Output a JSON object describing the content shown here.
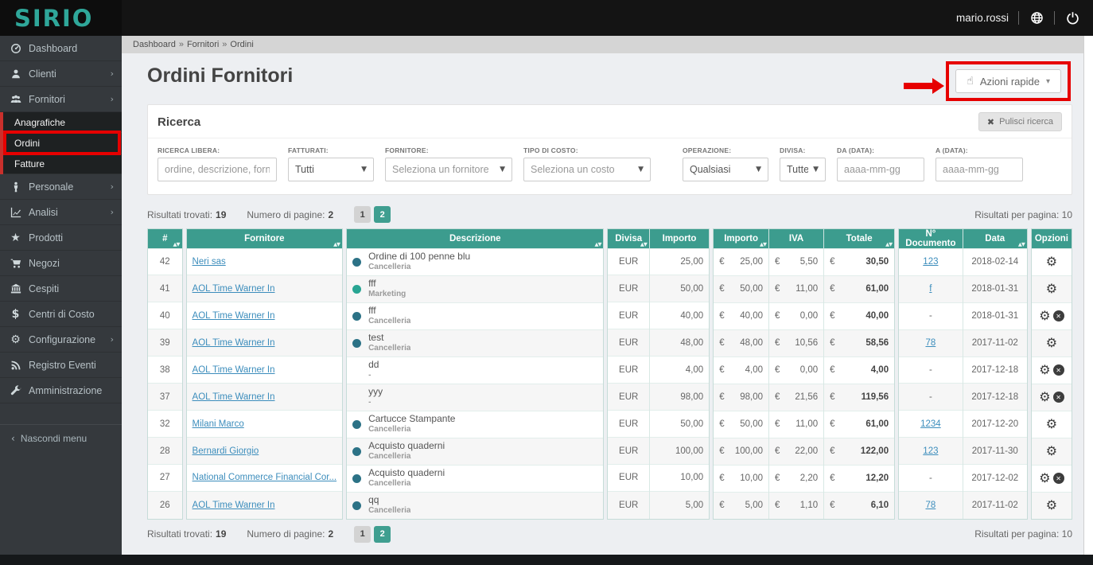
{
  "colors": {
    "accent_teal": "#3c9c8e",
    "logo_teal": "#2fa79a",
    "link_blue": "#3c8dbc",
    "annotation_red": "#e60000",
    "dot_blue": "#2c7286",
    "dot_teal": "#28a593",
    "sidebar_bg": "#35393d",
    "topbar_bg": "#141414"
  },
  "topbar": {
    "logo": "SIRIO",
    "username": "mario.rossi",
    "icons": [
      "globe-icon",
      "power-icon"
    ]
  },
  "sidebar": {
    "items": [
      {
        "id": "dashboard",
        "icon": "dashboard-icon",
        "label": "Dashboard"
      },
      {
        "id": "clienti",
        "icon": "user-icon",
        "label": "Clienti",
        "arrow": true
      },
      {
        "id": "fornitori",
        "icon": "users-icon",
        "label": "Fornitori",
        "arrow": true,
        "submenu": [
          {
            "id": "anagrafiche",
            "label": "Anagrafiche"
          },
          {
            "id": "ordini",
            "label": "Ordini",
            "annotated": true
          },
          {
            "id": "fatture",
            "label": "Fatture"
          }
        ]
      },
      {
        "id": "personale",
        "icon": "person-icon",
        "label": "Personale",
        "arrow": true
      },
      {
        "id": "analisi",
        "icon": "chart-icon",
        "label": "Analisi",
        "arrow": true
      },
      {
        "id": "prodotti",
        "icon": "star-icon",
        "label": "Prodotti"
      },
      {
        "id": "negozi",
        "icon": "cart-icon",
        "label": "Negozi"
      },
      {
        "id": "cespiti",
        "icon": "bank-icon",
        "label": "Cespiti"
      },
      {
        "id": "centri-di-costo",
        "icon": "dollar-icon",
        "label": "Centri di Costo"
      },
      {
        "id": "configurazione",
        "icon": "gear-icon",
        "label": "Configurazione",
        "arrow": true
      },
      {
        "id": "registro-eventi",
        "icon": "rss-icon",
        "label": "Registro Eventi"
      },
      {
        "id": "amministrazione",
        "icon": "wrench-icon",
        "label": "Amministrazione"
      }
    ],
    "hide_menu_label": "Nascondi menu"
  },
  "breadcrumb": [
    "Dashboard",
    "Fornitori",
    "Ordini"
  ],
  "page": {
    "title": "Ordini Fornitori"
  },
  "quick_actions": {
    "label": "Azioni rapide"
  },
  "search": {
    "panel_title": "Ricerca",
    "clear_label": "Pulisci ricerca",
    "fields": [
      {
        "label": "Ricerca libera:",
        "type": "text",
        "placeholder": "ordine, descrizione, forn"
      },
      {
        "label": "Fatturati:",
        "type": "select",
        "value": "Tutti",
        "placeholder_style": false
      },
      {
        "label": "Fornitore:",
        "type": "select",
        "value": "Seleziona un fornitore",
        "placeholder_style": true
      },
      {
        "label": "Tipo di costo:",
        "type": "select",
        "value": "Seleziona un costo",
        "placeholder_style": true
      },
      {
        "label": "Operazione:",
        "type": "select",
        "value": "Qualsiasi",
        "placeholder_style": false
      },
      {
        "label": "Divisa:",
        "type": "select",
        "value": "Tutte",
        "placeholder_style": false
      },
      {
        "label": "Da (data):",
        "type": "text",
        "placeholder": "aaaa-mm-gg"
      },
      {
        "label": "A (data):",
        "type": "text",
        "placeholder": "aaaa-mm-gg"
      }
    ]
  },
  "results": {
    "found_label": "Risultati trovati:",
    "found": "19",
    "pages_label": "Numero di pagine:",
    "pages": "2",
    "per_page_label": "Risultati per pagina:",
    "per_page": "10",
    "page_buttons": [
      "1",
      "2"
    ],
    "active_page": "2"
  },
  "table": {
    "columns": {
      "id": {
        "label": "#",
        "sortable": true
      },
      "fornitore": {
        "label": "Fornitore",
        "sortable": true
      },
      "descrizione": {
        "label": "Descrizione",
        "sortable": true
      },
      "divisa": {
        "label": "Divisa",
        "sortable": true
      },
      "importo": {
        "label": "Importo",
        "sortable": false
      },
      "importo2": {
        "label": "Importo",
        "sortable": true
      },
      "iva": {
        "label": "IVA",
        "sortable": false
      },
      "totale": {
        "label": "Totale",
        "sortable": true
      },
      "n_documento": {
        "label": "N° Documento",
        "sortable": false
      },
      "data": {
        "label": "Data",
        "sortable": true
      },
      "opzioni": {
        "label": "Opzioni",
        "sortable": false
      }
    },
    "currency_symbol": "€",
    "rows": [
      {
        "id": "42",
        "fornitore": "Neri sas",
        "descrizione": "Ordine di 100 penne blu",
        "categoria": "Cancelleria",
        "dot": "blue",
        "divisa": "EUR",
        "importo": "25,00",
        "importo2": "25,00",
        "iva": "5,50",
        "totale": "30,50",
        "n_documento": "123",
        "doc_link": true,
        "data": "2018-02-14",
        "opzioni": [
          "gear"
        ]
      },
      {
        "id": "41",
        "fornitore": "AOL Time Warner In",
        "descrizione": "fff",
        "categoria": "Marketing",
        "dot": "teal",
        "divisa": "EUR",
        "importo": "50,00",
        "importo2": "50,00",
        "iva": "11,00",
        "totale": "61,00",
        "n_documento": "f",
        "doc_link": true,
        "data": "2018-01-31",
        "opzioni": [
          "gear"
        ]
      },
      {
        "id": "40",
        "fornitore": "AOL Time Warner In",
        "descrizione": "fff",
        "categoria": "Cancelleria",
        "dot": "blue",
        "divisa": "EUR",
        "importo": "40,00",
        "importo2": "40,00",
        "iva": "0,00",
        "totale": "40,00",
        "n_documento": "-",
        "doc_link": false,
        "data": "2018-01-31",
        "opzioni": [
          "gear",
          "remove"
        ]
      },
      {
        "id": "39",
        "fornitore": "AOL Time Warner In",
        "descrizione": "test",
        "categoria": "Cancelleria",
        "dot": "blue",
        "divisa": "EUR",
        "importo": "48,00",
        "importo2": "48,00",
        "iva": "10,56",
        "totale": "58,56",
        "n_documento": "78",
        "doc_link": true,
        "data": "2017-11-02",
        "opzioni": [
          "gear"
        ]
      },
      {
        "id": "38",
        "fornitore": "AOL Time Warner In",
        "descrizione": "dd",
        "categoria": "-",
        "dot": "none",
        "divisa": "EUR",
        "importo": "4,00",
        "importo2": "4,00",
        "iva": "0,00",
        "totale": "4,00",
        "n_documento": "-",
        "doc_link": false,
        "data": "2017-12-18",
        "opzioni": [
          "gear",
          "remove"
        ]
      },
      {
        "id": "37",
        "fornitore": "AOL Time Warner In",
        "descrizione": "yyy",
        "categoria": "-",
        "dot": "none",
        "divisa": "EUR",
        "importo": "98,00",
        "importo2": "98,00",
        "iva": "21,56",
        "totale": "119,56",
        "n_documento": "-",
        "doc_link": false,
        "data": "2017-12-18",
        "opzioni": [
          "gear",
          "remove"
        ]
      },
      {
        "id": "32",
        "fornitore": "Milani Marco",
        "descrizione": "Cartucce Stampante",
        "categoria": "Cancelleria",
        "dot": "blue",
        "divisa": "EUR",
        "importo": "50,00",
        "importo2": "50,00",
        "iva": "11,00",
        "totale": "61,00",
        "n_documento": "1234",
        "doc_link": true,
        "data": "2017-12-20",
        "opzioni": [
          "gear"
        ]
      },
      {
        "id": "28",
        "fornitore": "Bernardi Giorgio",
        "descrizione": "Acquisto quaderni",
        "categoria": "Cancelleria",
        "dot": "blue",
        "divisa": "EUR",
        "importo": "100,00",
        "importo2": "100,00",
        "iva": "22,00",
        "totale": "122,00",
        "n_documento": "123",
        "doc_link": true,
        "data": "2017-11-30",
        "opzioni": [
          "gear"
        ]
      },
      {
        "id": "27",
        "fornitore": "National Commerce Financial Cor...",
        "descrizione": "Acquisto quaderni",
        "categoria": "Cancelleria",
        "dot": "blue",
        "divisa": "EUR",
        "importo": "10,00",
        "importo2": "10,00",
        "iva": "2,20",
        "totale": "12,20",
        "n_documento": "-",
        "doc_link": false,
        "data": "2017-12-02",
        "opzioni": [
          "gear",
          "remove"
        ]
      },
      {
        "id": "26",
        "fornitore": "AOL Time Warner In",
        "descrizione": "qq",
        "categoria": "Cancelleria",
        "dot": "blue",
        "divisa": "EUR",
        "importo": "5,00",
        "importo2": "5,00",
        "iva": "1,10",
        "totale": "6,10",
        "n_documento": "78",
        "doc_link": true,
        "data": "2017-11-02",
        "opzioni": [
          "gear"
        ]
      }
    ]
  }
}
